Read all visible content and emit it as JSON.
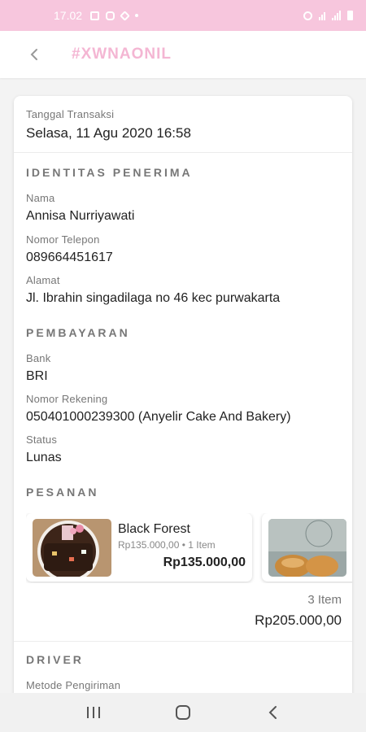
{
  "status_bar": {
    "time": "17.02"
  },
  "app_bar": {
    "title": "#XWNAONIL"
  },
  "transaction": {
    "date_label": "Tanggal Transaksi",
    "date_value": "Selasa, 11 Agu 2020 16:58"
  },
  "recipient": {
    "section_title": "IDENTITAS PENERIMA",
    "name_label": "Nama",
    "name_value": "Annisa Nurriyawati",
    "phone_label": "Nomor Telepon",
    "phone_value": "089664451617",
    "address_label": "Alamat",
    "address_value": "Jl. Ibrahin singadilaga no 46 kec purwakarta"
  },
  "payment": {
    "section_title": "PEMBAYARAN",
    "bank_label": "Bank",
    "bank_value": "BRI",
    "account_label": "Nomor Rekening",
    "account_value": "050401000239300 (Anyelir Cake And Bakery)",
    "status_label": "Status",
    "status_value": "Lunas"
  },
  "orders": {
    "section_title": "PESANAN",
    "items": [
      {
        "name": "Black Forest",
        "subtitle": "Rp135.000,00 • 1 Item",
        "price": "Rp135.000,00"
      }
    ],
    "total_items": "3 Item",
    "total_price": "Rp205.000,00"
  },
  "driver": {
    "section_title": "DRIVER",
    "method_label": "Metode Pengiriman"
  },
  "colors": {
    "accent_pink": "#f4b6d3",
    "status_bar": "#f7c6dd"
  }
}
